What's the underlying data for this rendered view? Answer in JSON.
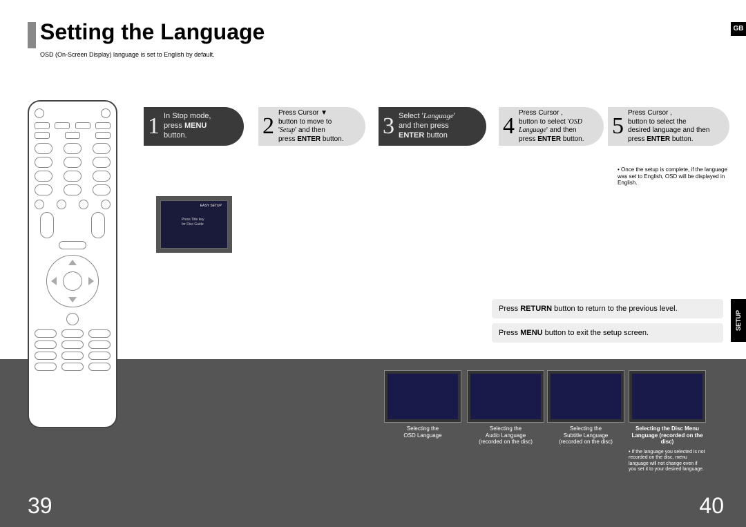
{
  "title": "Setting the Language",
  "subtitle": "OSD (On-Screen Display) language is set to English by default.",
  "lang_badge": "GB",
  "side_tab": "SETUP",
  "steps": {
    "s1": {
      "num": "1",
      "line1": "In Stop mode,",
      "line2a": "press ",
      "line2b": "MENU",
      "line3": "button."
    },
    "s2": {
      "num": "2",
      "line1": "Press Cursor",
      "line1icon": "▼",
      "line2": "button to move to",
      "line3a": "'",
      "line3b": "Setup",
      "line3c": "' and then",
      "line4a": "press ",
      "line4b": "ENTER",
      "line4c": " button."
    },
    "s3": {
      "num": "3",
      "line1a": "Select '",
      "line1b": "Language",
      "line1c": "'",
      "line2": "and then press",
      "line3a": "ENTER",
      "line3b": " button"
    },
    "s4": {
      "num": "4",
      "line1a": "Press Cursor ",
      "line1b": ",",
      "line2a": "button to select '",
      "line2b": "OSD",
      "line3a": "Language",
      "line3b": "' and then",
      "line4a": "press ",
      "line4b": "ENTER",
      "line4c": " button."
    },
    "s5": {
      "num": "5",
      "line1a": "Press Cursor ",
      "line1b": ",",
      "line2": "button to select the",
      "line3": "desired language and then",
      "line4a": "press ",
      "line4b": "ENTER",
      "line4c": " button."
    }
  },
  "note_top": "Once the setup is complete, if the language was set to English, OSD will be displayed in English.",
  "hints": {
    "h1a": "Press ",
    "h1b": "RETURN",
    "h1c": " button to return to the previous level.",
    "h2a": "Press ",
    "h2b": "MENU",
    "h2c": " button to exit the setup screen."
  },
  "thumbs": {
    "t1": {
      "caption_l1": "Selecting the",
      "caption_l2": "OSD Language"
    },
    "t2": {
      "caption_l1": "Selecting the",
      "caption_l2": "Audio Language",
      "caption_l3": "(recorded on the disc)"
    },
    "t3": {
      "caption_l1": "Selecting the",
      "caption_l2": "Subtitle Language",
      "caption_l3": "(recorded on the disc)"
    },
    "t4": {
      "caption_l1": "Selecting the Disc Menu",
      "caption_l2": "Language (recorded on the disc)",
      "note": "If the language you selected is not recorded on the disc, menu language will not change even if you set it to your desired language."
    }
  },
  "page_left": "39",
  "page_right": "40",
  "screenshot1": {
    "title": "EASY SETUP",
    "line1": "Press Title key",
    "line2": "for Disc Guide"
  }
}
